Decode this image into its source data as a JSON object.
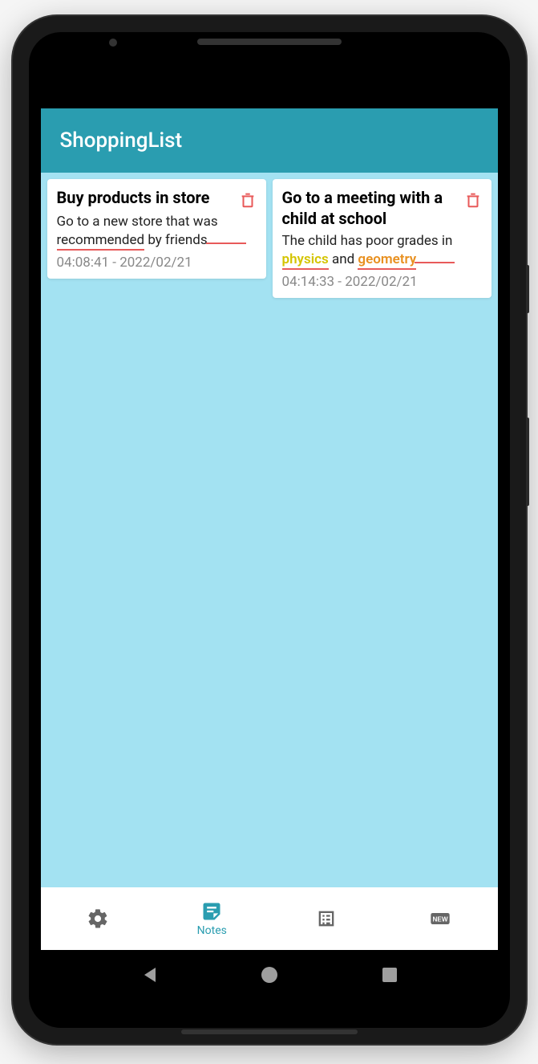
{
  "app": {
    "title": "ShoppingList"
  },
  "notes": [
    {
      "title": "Buy products in store",
      "body_parts": {
        "pre": "Go to a new store that was ",
        "u_word": "recommended",
        "post": " by friends"
      },
      "timestamp": "04:08:41 - 2022/02/21"
    },
    {
      "title": "Go to a meeting with a child at school",
      "body_parts": {
        "pre": "The child has poor grades in ",
        "hl1": "physics",
        "mid": " and ",
        "hl2": "geometry"
      },
      "timestamp": "04:14:33 - 2022/02/21"
    }
  ],
  "bottomNav": {
    "activeLabel": "Notes"
  }
}
